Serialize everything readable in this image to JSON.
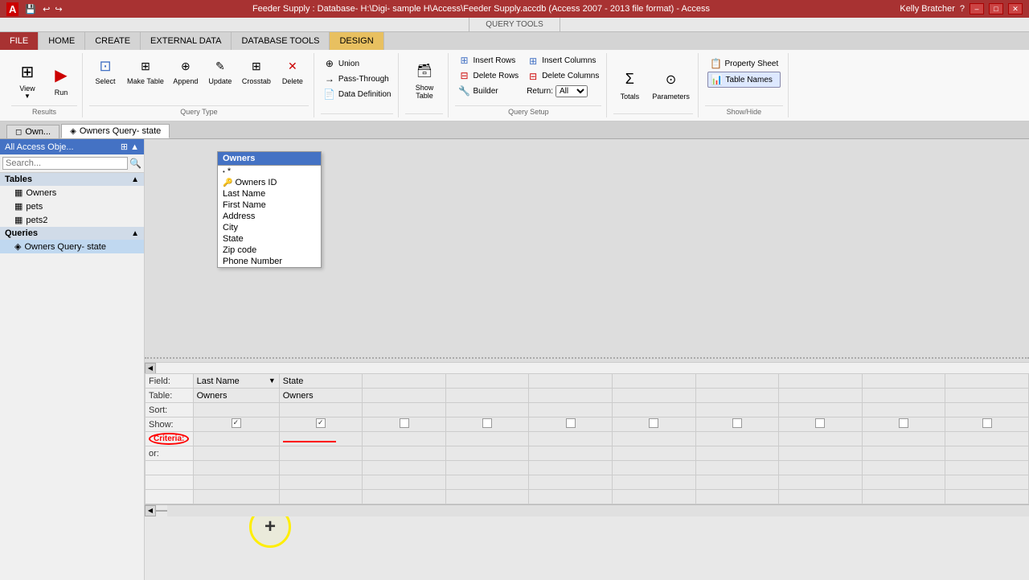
{
  "titleBar": {
    "appIcon": "A",
    "title": "Feeder Supply : Database- H:\\Digi- sample H\\Access\\Feeder Supply.accdb (Access 2007 - 2013 file format) - Access",
    "user": "Kelly Bratcher",
    "btnMin": "–",
    "btnMax": "□",
    "btnClose": "✕"
  },
  "ribbonTabs": {
    "queryToolsLabel": "QUERY TOOLS",
    "tabs": [
      "FILE",
      "HOME",
      "CREATE",
      "EXTERNAL DATA",
      "DATABASE TOOLS",
      "DESIGN"
    ],
    "activeTab": "DESIGN",
    "queryToolsTab": "QUERY TOOLS"
  },
  "ribbonGroups": {
    "results": {
      "label": "Results",
      "buttons": [
        "View",
        "Run",
        "Select",
        "Make Table",
        "Append",
        "Update",
        "Crosstab",
        "Delete"
      ]
    },
    "queryType": {
      "label": "Query Type",
      "items": [
        "Union",
        "Pass-Through",
        "Data Definition"
      ]
    },
    "showTable": {
      "label": "Show Table",
      "btnLabel": "Show Table"
    },
    "querySetup": {
      "label": "Query Setup",
      "items": [
        "Insert Rows",
        "Delete Rows",
        "Builder",
        "Insert Columns",
        "Delete Columns",
        "Return: All"
      ]
    },
    "totals": {
      "label": "",
      "items": [
        "Totals",
        "Parameters"
      ]
    },
    "showHide": {
      "label": "Show/Hide",
      "items": [
        "Property Sheet",
        "Table Names"
      ]
    }
  },
  "tabs": {
    "items": [
      {
        "label": "Own...",
        "icon": "◻",
        "active": false
      },
      {
        "label": "Owners Query- state",
        "icon": "◈",
        "active": true
      }
    ]
  },
  "navPane": {
    "title": "All Access Obje...",
    "searchPlaceholder": "Search...",
    "sections": [
      {
        "label": "Tables",
        "items": [
          {
            "label": "Owners",
            "icon": "▦"
          },
          {
            "label": "pets",
            "icon": "▦"
          },
          {
            "label": "pets2",
            "icon": "▦"
          }
        ]
      },
      {
        "label": "Queries",
        "items": [
          {
            "label": "Owners Query- state",
            "icon": "◈",
            "selected": true
          }
        ]
      }
    ]
  },
  "ownersTable": {
    "title": "Owners",
    "fields": [
      {
        "name": "*",
        "type": "bullet"
      },
      {
        "name": "Owners ID",
        "type": "key"
      },
      {
        "name": "Last Name",
        "type": "normal"
      },
      {
        "name": "First Name",
        "type": "normal"
      },
      {
        "name": "Address",
        "type": "normal"
      },
      {
        "name": "City",
        "type": "normal"
      },
      {
        "name": "State",
        "type": "normal"
      },
      {
        "name": "Zip code",
        "type": "normal"
      },
      {
        "name": "Phone Number",
        "type": "normal"
      }
    ]
  },
  "queryGrid": {
    "rowLabels": [
      "Field:",
      "Table:",
      "Sort:",
      "Show:",
      "Criteria:"
    ],
    "columns": [
      {
        "field": "Last Name",
        "table": "Owners",
        "sort": "",
        "show": true,
        "criteria": "",
        "hasRedLine": false
      },
      {
        "field": "State",
        "table": "Owners",
        "sort": "",
        "show": true,
        "criteria": "",
        "hasRedLine": true
      },
      {
        "field": "",
        "table": "",
        "sort": "",
        "show": false,
        "criteria": ""
      },
      {
        "field": "",
        "table": "",
        "sort": "",
        "show": false,
        "criteria": ""
      },
      {
        "field": "",
        "table": "",
        "sort": "",
        "show": false,
        "criteria": ""
      },
      {
        "field": "",
        "table": "",
        "sort": "",
        "show": false,
        "criteria": ""
      },
      {
        "field": "",
        "table": "",
        "sort": "",
        "show": false,
        "criteria": ""
      },
      {
        "field": "",
        "table": "",
        "sort": "",
        "show": false,
        "criteria": ""
      },
      {
        "field": "",
        "table": "",
        "sort": "",
        "show": false,
        "criteria": ""
      },
      {
        "field": "",
        "table": "",
        "sort": "",
        "show": false,
        "criteria": ""
      }
    ]
  },
  "propertySheet": {
    "title": "Property Sheet",
    "tableNames": "Table Names"
  },
  "cursor": {
    "symbol": "+"
  }
}
